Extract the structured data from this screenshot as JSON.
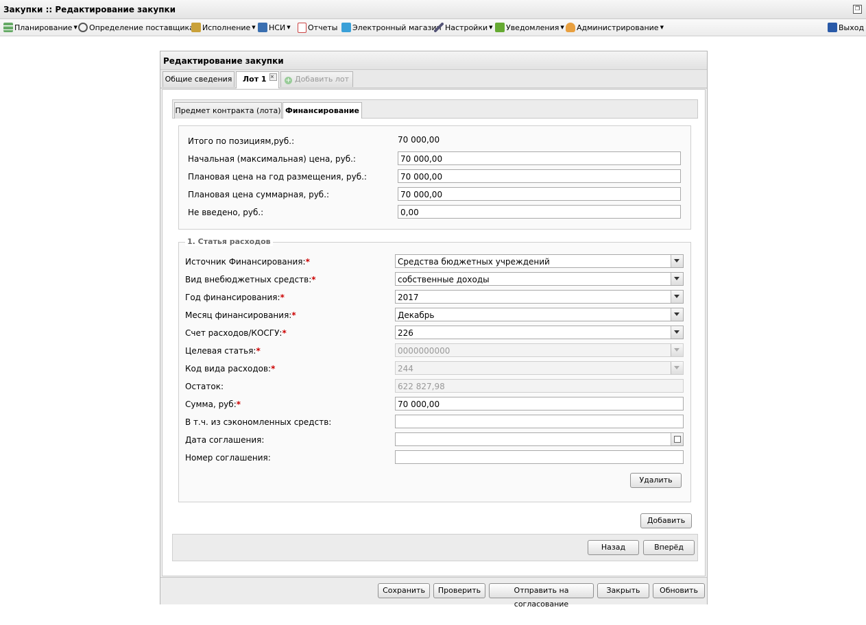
{
  "window_title": "Закупки :: Редактирование закупки",
  "menu": [
    {
      "label": "Планирование",
      "icon": "planning-icon",
      "dropdown": true
    },
    {
      "label": "Определение поставщика",
      "icon": "gears-icon",
      "dropdown": true
    },
    {
      "label": "Исполнение",
      "icon": "execution-icon",
      "dropdown": true
    },
    {
      "label": "НСИ",
      "icon": "book-icon",
      "dropdown": true
    },
    {
      "label": "Отчеты",
      "icon": "report-icon",
      "dropdown": false
    },
    {
      "label": "Электронный магазин",
      "icon": "cart-icon",
      "dropdown": false
    },
    {
      "label": "Настройки",
      "icon": "wrench-icon",
      "dropdown": true
    },
    {
      "label": "Уведомления",
      "icon": "notification-icon",
      "dropdown": true
    },
    {
      "label": "Администрирование",
      "icon": "user-icon",
      "dropdown": true
    }
  ],
  "exit_label": "Выход",
  "panel_title": "Редактирование закупки",
  "tabs": {
    "general": "Общие сведения",
    "lot": "Лот 1",
    "add_lot": "Добавить лот"
  },
  "subtabs": {
    "subject": "Предмет контракта (лота)",
    "financing": "Финансирование"
  },
  "totals": {
    "total_label": "Итого по позициям,руб.:",
    "total_value": "70 000,00",
    "initial_label": "Начальная (максимальная) цена, руб.:",
    "initial_value": "70 000,00",
    "plan_year_label": "Плановая цена на год размещения, руб.:",
    "plan_year_value": "70 000,00",
    "plan_sum_label": "Плановая цена суммарная, руб.:",
    "plan_sum_value": "70 000,00",
    "not_entered_label": "Не введено, руб.:",
    "not_entered_value": "0,00"
  },
  "expense": {
    "legend": "1. Статья расходов",
    "source_label": "Источник Финансирования:",
    "source_value": "Средства бюджетных учреждений",
    "offbudget_label": "Вид внебюджетных средств:",
    "offbudget_value": "собственные доходы",
    "year_label": "Год финансирования:",
    "year_value": "2017",
    "month_label": "Месяц финансирования:",
    "month_value": "Декабрь",
    "account_label": "Счет расходов/КОСГУ:",
    "account_value": "226",
    "target_label": "Целевая статья:",
    "target_value": "0000000000",
    "kvr_label": "Код вида расходов:",
    "kvr_value": "244",
    "rest_label": "Остаток:",
    "rest_value": "622 827,98",
    "sum_label": "Сумма, руб:",
    "sum_value": "70 000,00",
    "saved_label": "В т.ч. из сэкономленных средств:",
    "saved_value": "",
    "agreement_date_label": "Дата соглашения:",
    "agreement_date_value": "",
    "agreement_num_label": "Номер соглашения:",
    "agreement_num_value": "",
    "delete_label": "Удалить"
  },
  "add_label": "Добавить",
  "nav": {
    "back": "Назад",
    "forward": "Вперёд"
  },
  "footer": {
    "save": "Сохранить",
    "check": "Проверить",
    "send": "Отправить на согласование",
    "close": "Закрыть",
    "refresh": "Обновить"
  }
}
